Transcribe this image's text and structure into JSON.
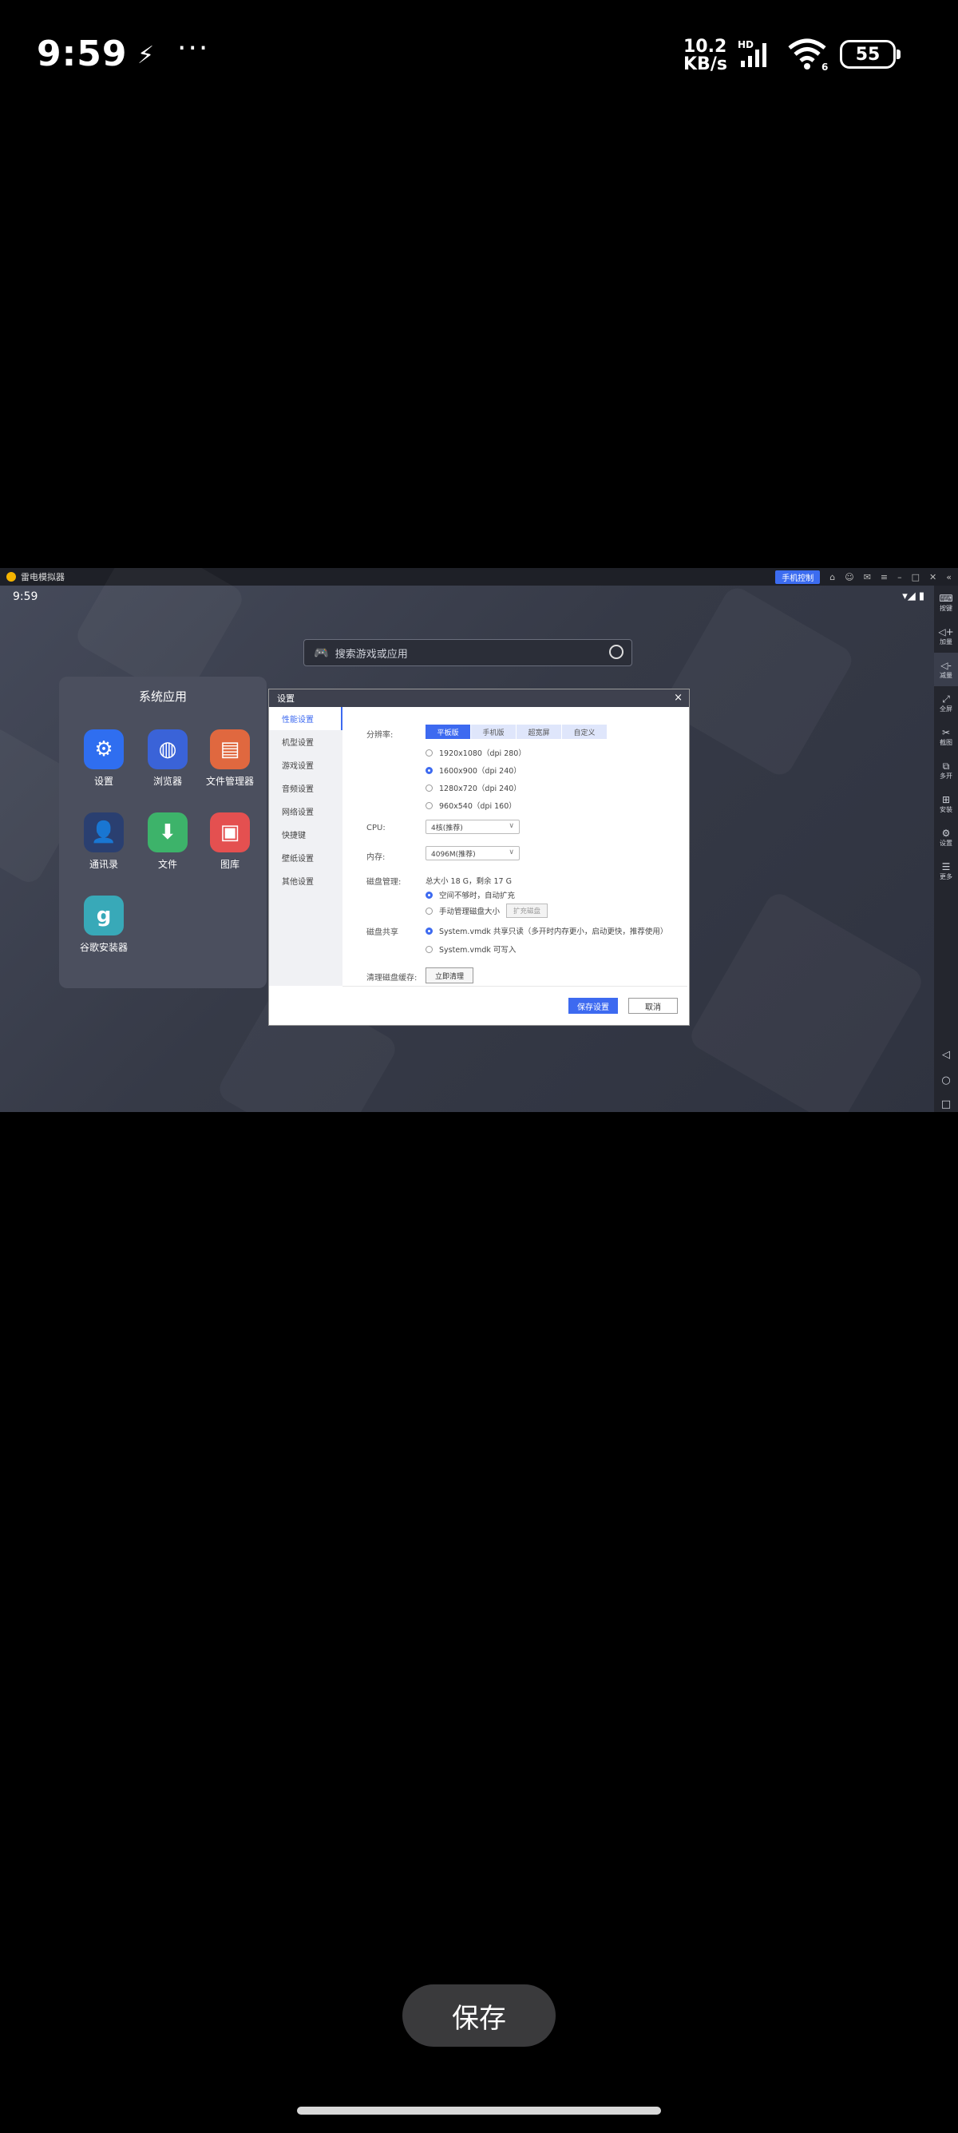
{
  "status_bar": {
    "time": "9:59",
    "notif_symbol": "⚡",
    "more": "···",
    "net_speed": "10.2",
    "net_unit": "KB/s",
    "battery": "55"
  },
  "emulator": {
    "title": "雷电模拟器",
    "phone_control": "手机控制",
    "android_time": "9:59",
    "search_placeholder": "搜索游戏或应用",
    "apps_title": "系统应用",
    "apps": [
      {
        "label": "设置",
        "icon": "gear-icon",
        "color": "#2f6ef0",
        "glyph": "⚙"
      },
      {
        "label": "浏览器",
        "icon": "globe-icon",
        "color": "#3a63d8",
        "glyph": "◍"
      },
      {
        "label": "文件管理器",
        "icon": "folder-icon",
        "color": "#e0683f",
        "glyph": "▤"
      },
      {
        "label": "通讯录",
        "icon": "contact-icon",
        "color": "#2a3f70",
        "glyph": "👤"
      },
      {
        "label": "文件",
        "icon": "download-icon",
        "color": "#3db36a",
        "glyph": "⬇"
      },
      {
        "label": "图库",
        "icon": "image-icon",
        "color": "#e45050",
        "glyph": "▣"
      },
      {
        "label": "谷歌安装器",
        "icon": "google-installer-icon",
        "color": "#38a9b8",
        "glyph": "g"
      }
    ],
    "toolbar": [
      {
        "label": "按键",
        "icon": "keyboard-icon",
        "glyph": "⌨"
      },
      {
        "label": "加量",
        "icon": "volume-up-icon",
        "glyph": "◁+"
      },
      {
        "label": "减量",
        "icon": "volume-down-icon",
        "glyph": "◁-"
      },
      {
        "label": "全屏",
        "icon": "fullscreen-icon",
        "glyph": "⤢"
      },
      {
        "label": "截图",
        "icon": "scissors-icon",
        "glyph": "✂"
      },
      {
        "label": "多开",
        "icon": "multi-instance-icon",
        "glyph": "⧉"
      },
      {
        "label": "安装",
        "icon": "apk-icon",
        "glyph": "⊞"
      },
      {
        "label": "设置",
        "icon": "settings-icon",
        "glyph": "⚙"
      },
      {
        "label": "更多",
        "icon": "more-icon",
        "glyph": "☰"
      }
    ]
  },
  "dialog": {
    "title": "设置",
    "sidebar": [
      "性能设置",
      "机型设置",
      "游戏设置",
      "音频设置",
      "网络设置",
      "快捷键",
      "壁纸设置",
      "其他设置"
    ],
    "resolution_label": "分辨率:",
    "resolution_tabs": [
      "平板版",
      "手机版",
      "超宽屏",
      "自定义"
    ],
    "resolutions": [
      "1920x1080（dpi 280）",
      "1600x900（dpi 240）",
      "1280x720（dpi 240）",
      "960x540（dpi 160）"
    ],
    "cpu_label": "CPU:",
    "cpu_value": "4核(推荐)",
    "memory_label": "内存:",
    "memory_value": "4096M(推荐)",
    "disk_label": "磁盘管理:",
    "disk_info": "总大小 18 G，剩余 17 G",
    "disk_opt1": "空间不够时，自动扩充",
    "disk_opt2": "手动管理磁盘大小",
    "expand_button": "扩充磁盘",
    "share_label": "磁盘共享",
    "share_opt1": "System.vmdk 共享只读（多开时内存更小，启动更快，推荐使用）",
    "share_opt2": "System.vmdk 可写入",
    "clean_label": "清理磁盘缓存:",
    "clean_button": "立即清理",
    "save_button": "保存设置",
    "cancel_button": "取消"
  },
  "bottom": {
    "save_label": "保存"
  }
}
